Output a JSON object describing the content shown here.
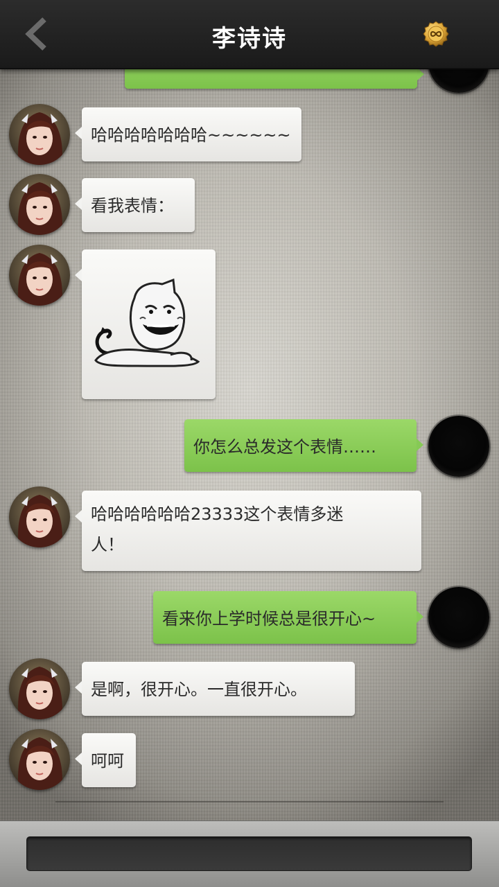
{
  "header": {
    "title": "李诗诗",
    "back_icon": "chevron-left-icon",
    "coin_icon": "coin-icon",
    "accent": "#d9a43a"
  },
  "messages": [
    {
      "side": "out",
      "text": ""
    },
    {
      "side": "in",
      "text": "哈哈哈哈哈哈哈~~~~~~"
    },
    {
      "side": "in",
      "text": "看我表情："
    },
    {
      "side": "in",
      "type": "sticker",
      "sticker_name": "troll-cat-sticker"
    },
    {
      "side": "out",
      "text": "你怎么总发这个表情……"
    },
    {
      "side": "in",
      "line1": "哈哈哈哈哈哈23333这个表情多迷",
      "line2": "人！"
    },
    {
      "side": "out",
      "text": "看来你上学时候总是很开心~"
    },
    {
      "side": "in",
      "text": "是啊，很开心。一直很开心。"
    },
    {
      "side": "in",
      "text": "呵呵"
    }
  ],
  "input": {
    "value": ""
  },
  "colors": {
    "bubble_out": "#86c955",
    "bubble_in": "#f3f3f1",
    "header_bg": "#222222"
  }
}
